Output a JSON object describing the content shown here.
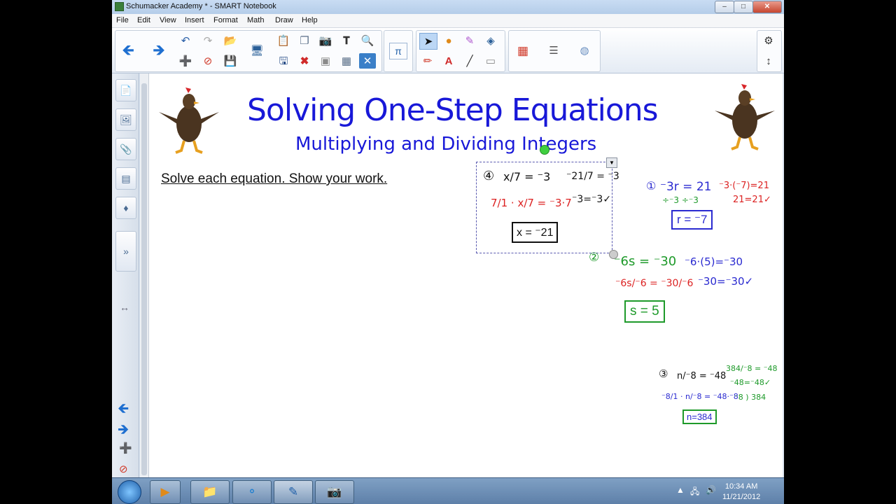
{
  "window": {
    "title": "Schumacker Academy * - SMART Notebook",
    "controls": [
      "–",
      "□",
      "✕"
    ]
  },
  "menu": [
    "File",
    "Edit",
    "View",
    "Insert",
    "Format",
    "Math",
    "Draw",
    "Help"
  ],
  "slide": {
    "title": "Solving One-Step Equations",
    "subtitle": "Multiplying and Dividing Integers",
    "instruction": "Solve each equation.  Show your work."
  },
  "ink": {
    "p1_number": "①",
    "p1_equation": "⁻3r = 21",
    "p1_divide": "÷⁻3   ÷⁻3",
    "p1_check_line1": "⁻3·(⁻7)=21",
    "p1_check_line2": "21=21✓",
    "p1_answer": "r = ⁻7",
    "p2_number": "②",
    "p2_equation": "⁻6s = ⁻30",
    "p2_divide": "⁻6s/⁻6 = ⁻30/⁻6",
    "p2_check_line1": "⁻6·(5)=⁻30",
    "p2_check_line2": "⁻30=⁻30✓",
    "p2_answer": "s = 5",
    "p3_number": "③",
    "p3_equation": "n/⁻8 = ⁻48",
    "p3_multiply": "⁻8/1 · n/⁻8 = ⁻48·⁻8",
    "p3_answer": "n=384",
    "p3_check_line1": "384/⁻8 = ⁻48",
    "p3_check_line2": "⁻48=⁻48✓",
    "p3_division": "⁻8 ) 384",
    "p4_number": "④",
    "p4_equation": "x/7 = ⁻3",
    "p4_multiply": "7/1 · x/7 = ⁻3·7",
    "p4_answer": "x = ⁻21",
    "p4_check_line1": "⁻21/7 = ⁻3",
    "p4_check_line2": "⁻3=⁻3✓"
  },
  "taskbar": {
    "clock_time": "10:34 AM",
    "clock_date": "11/21/2012"
  },
  "colors": {
    "title_blue": "#1818d8",
    "ink_blue": "#2a2ad0",
    "ink_green": "#1e9a2a",
    "ink_red": "#dc2222"
  }
}
